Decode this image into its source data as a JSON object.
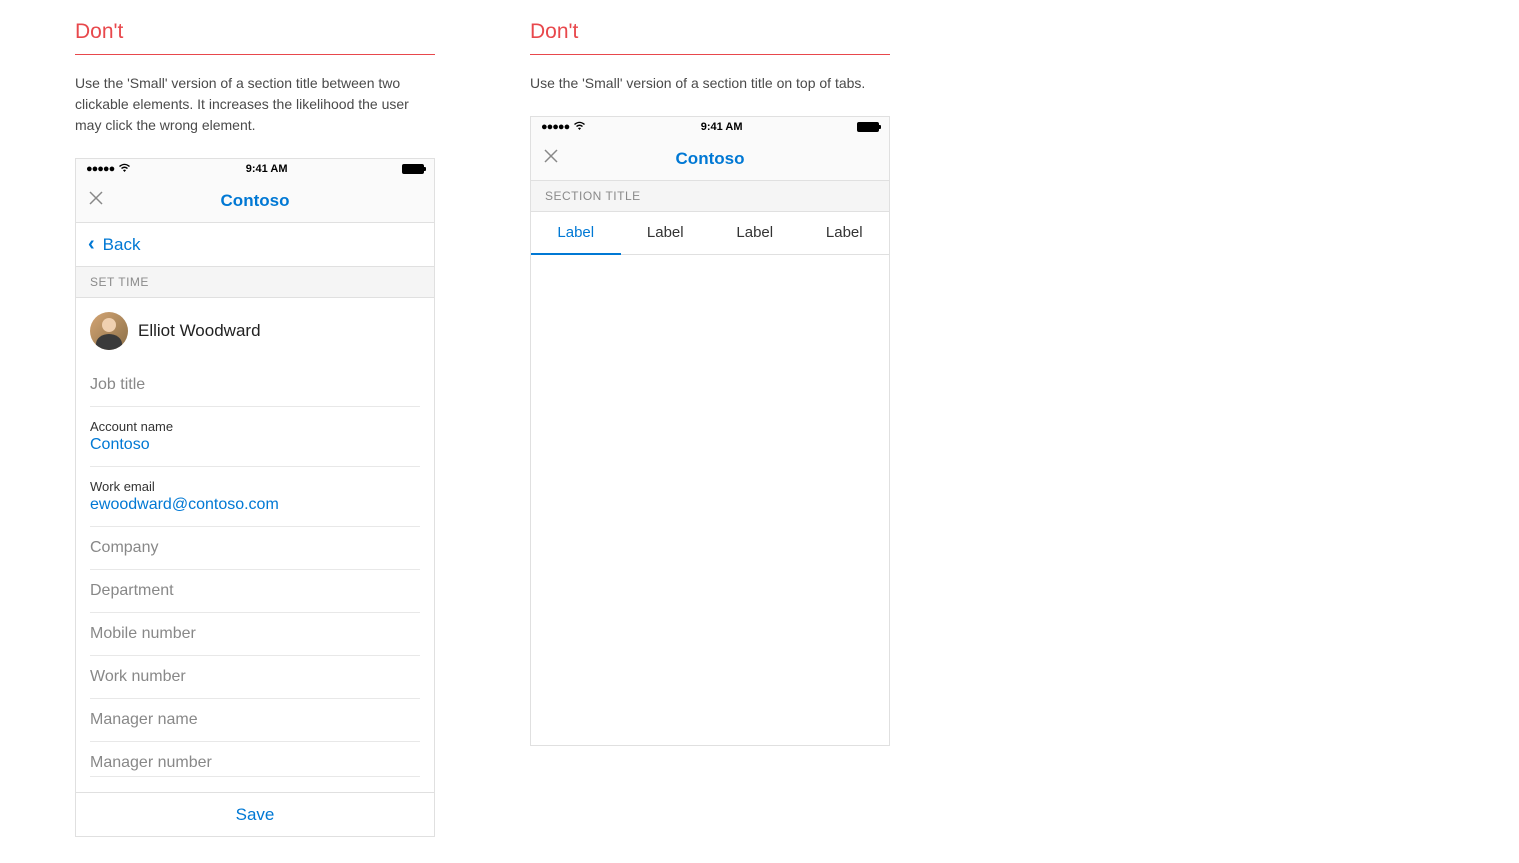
{
  "example1": {
    "header": "Don't",
    "description": "Use the 'Small' version of a section title between two clickable elements. It increases the likelihood the user may click the wrong element.",
    "statusBar": {
      "time": "9:41 AM"
    },
    "navTitle": "Contoso",
    "backLabel": "Back",
    "sectionTitle": "SET TIME",
    "contactName": "Elliot Woodward",
    "fields": {
      "jobTitle": "Job title",
      "accountNameLabel": "Account name",
      "accountNameValue": "Contoso",
      "workEmailLabel": "Work email",
      "workEmailValue": "ewoodward@contoso.com",
      "company": "Company",
      "department": "Department",
      "mobileNumber": "Mobile number",
      "workNumber": "Work number",
      "managerName": "Manager name",
      "managerNumber": "Manager number"
    },
    "saveLabel": "Save"
  },
  "example2": {
    "header": "Don't",
    "description": "Use the 'Small' version of a section title on top of tabs.",
    "statusBar": {
      "time": "9:41 AM"
    },
    "navTitle": "Contoso",
    "sectionTitle": "SECTION TITLE",
    "tabs": [
      "Label",
      "Label",
      "Label",
      "Label"
    ]
  }
}
